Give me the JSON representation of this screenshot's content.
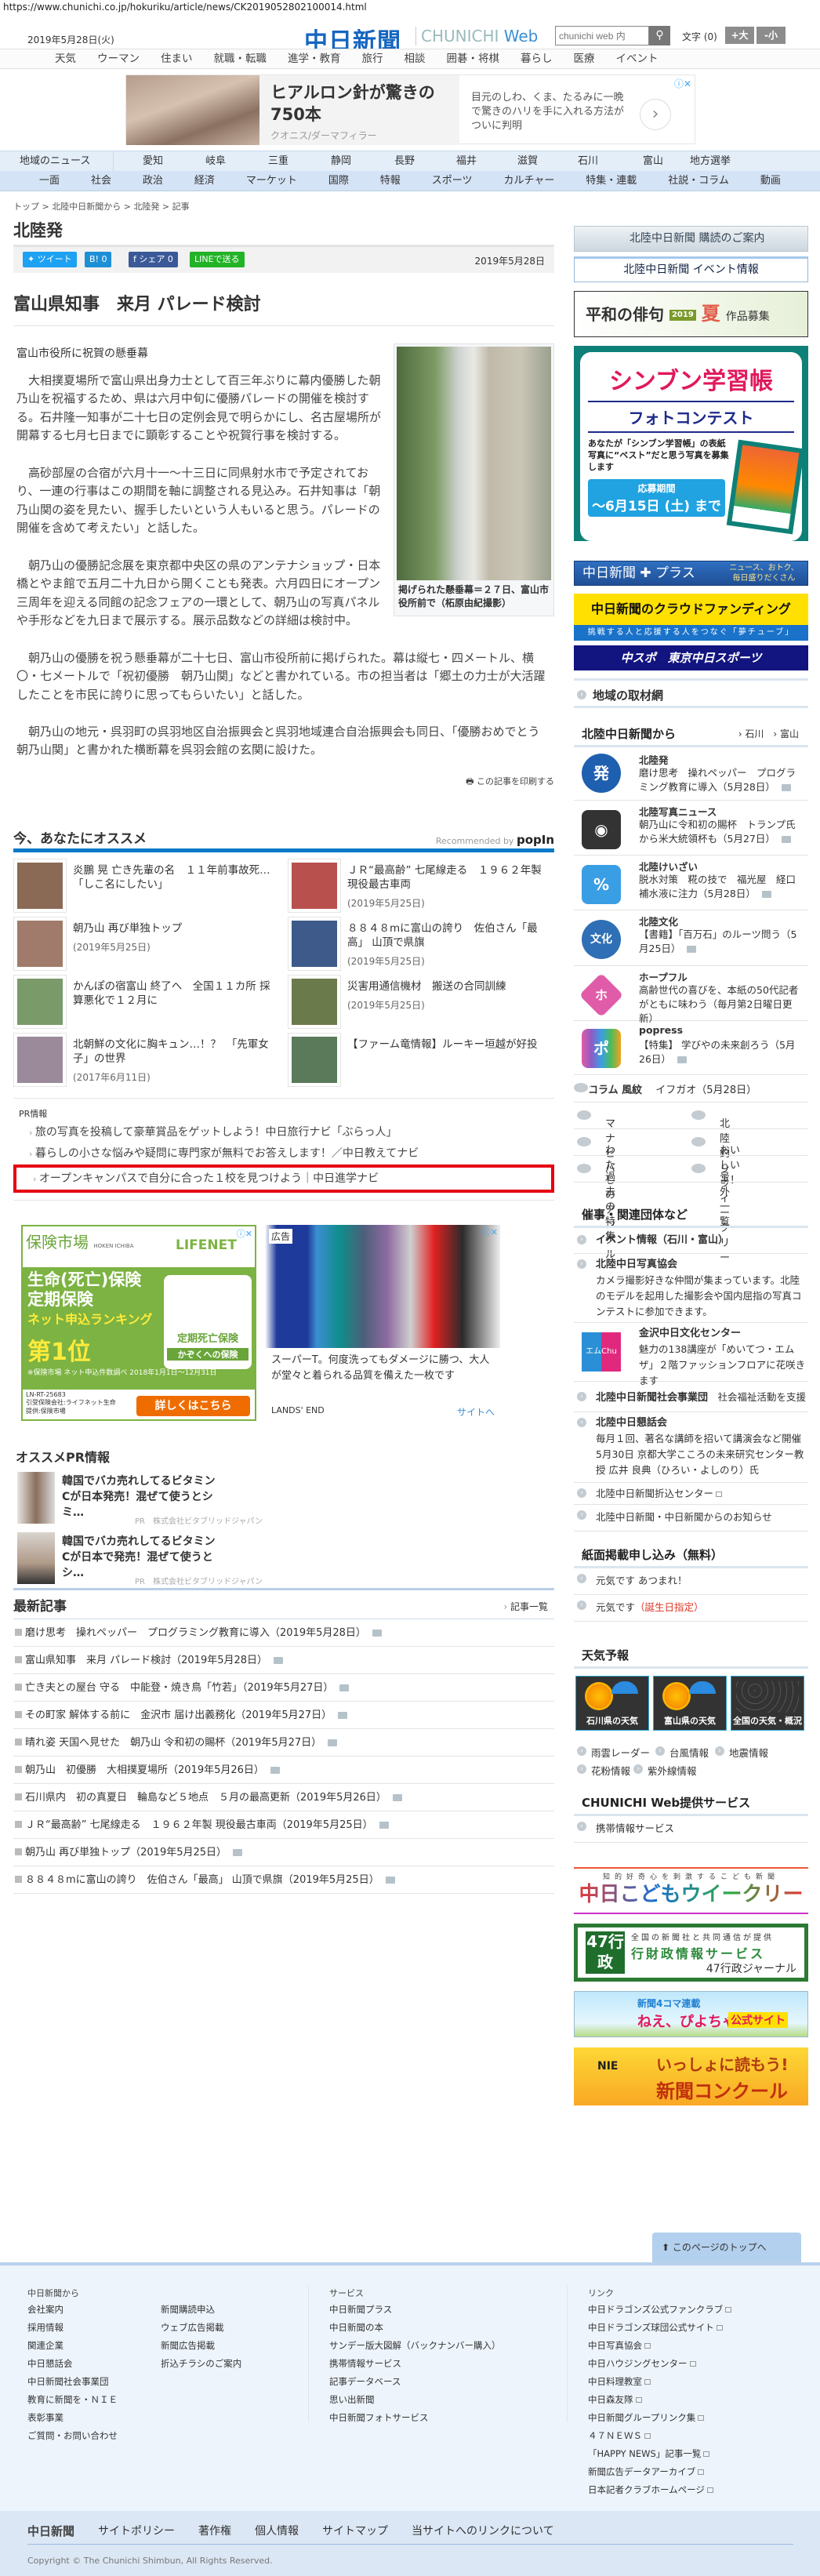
{
  "url": "https://www.chunichi.co.jp/hokuriku/article/news/CK2019052802100014.html",
  "header": {
    "date": "2019年5月28日(火)",
    "logo": "中日新聞",
    "logo_sub_a": "CHUNICHI",
    "logo_sub_b": "Web",
    "search_placeholder": "chunichi web 内",
    "font_label": "文字 (0)",
    "font_larger": "+大",
    "font_smaller": "-小"
  },
  "nav_top": [
    "天気",
    "ウーマン",
    "住まい",
    "就職・転職",
    "進学・教育",
    "旅行",
    "相談",
    "囲碁・将棋",
    "暮らし",
    "医療",
    "イベント"
  ],
  "top_ad": {
    "headline": "ヒアルロン針が驚きの750本",
    "advertiser": "クオニス/ダーマフィラー",
    "body": "目元のしわ、くま、たるみに一晩で驚きのハリを手に入れる方法がついに判明"
  },
  "nav_region": {
    "lead": "地域のニュース",
    "items": [
      "愛知",
      "岐阜",
      "三重",
      "静岡",
      "長野",
      "福井",
      "滋賀",
      "石川",
      "富山",
      "地方選挙"
    ]
  },
  "nav_category": [
    "一面",
    "社会",
    "政治",
    "経済",
    "マーケット",
    "国際",
    "特報",
    "スポーツ",
    "カルチャー",
    "特集・連載",
    "社説・コラム",
    "動画"
  ],
  "breadcrumb": "トップ > 北陸中日新聞から > 北陸発 > 記事",
  "page_title": "北陸発",
  "share": {
    "tweet": "ツイート",
    "hatena": "B! 0",
    "facebook": "f シェア 0",
    "line": "LINEで送る"
  },
  "article": {
    "date": "2019年5月28日",
    "headline": "富山県知事　来月 パレード検討",
    "subtitle": "富山市役所に祝賀の懸垂幕",
    "photo_caption": "掲げられた懸垂幕＝２７日、富山市役所前で（柘原由紀撮影）",
    "paragraphs": [
      "大相撲夏場所で富山県出身力士として百三年ぶりに幕内優勝した朝乃山を祝福するため、県は六月中旬に優勝パレードの開催を検討する。石井隆一知事が二十七日の定例会見で明らかにし、名古屋場所が開幕する七月七日までに顕彰することや祝賀行事を検討する。",
      "高砂部屋の合宿が六月十一～十三日に同県射水市で予定されており、一連の行事はこの期間を軸に調整される見込み。石井知事は「朝乃山関の姿を見たい、握手したいという人もいると思う。パレードの開催を含めて考えたい」と話した。",
      "朝乃山の優勝記念展を東京都中央区の県のアンテナショップ・日本橋とやま館で五月二十九日から開くことも発表。六月四日にオープン三周年を迎える同館の記念フェアの一環として、朝乃山の写真パネルや手形などを九日まで展示する。展示品数などの詳細は検討中。",
      "朝乃山の優勝を祝う懸垂幕が二十七日、富山市役所前に掲げられた。幕は縦七・四メートル、横〇・七メートルで「祝初優勝　朝乃山関」などと書かれている。市の担当者は「郷土の力士が大活躍したことを市民に誇りに思ってもらいたい」と話した。",
      "朝乃山の地元・呉羽町の呉羽地区自治振興会と呉羽地域連合自治振興会も同日、「優勝おめでとう　朝乃山関」と書かれた横断幕を呉羽会館の玄関に設けた。"
    ],
    "print_label": "この記事を印刷する"
  },
  "recommend": {
    "title": "今、あなたにオススメ",
    "by": "Recommended by",
    "brand": "popIn",
    "items": [
      {
        "title": "炎鵬 晃 亡き先輩の名　１１年前事故死…「しこ名にしたい」",
        "date": "",
        "color": "#8a6a55"
      },
      {
        "title": "ＪＲ“最高齢” 七尾線走る　１９６２年製 現役最古車両",
        "date": "(2019年5月25日)",
        "color": "#b8504e"
      },
      {
        "title": "朝乃山 再び単独トップ",
        "date": "(2019年5月25日)",
        "color": "#a07a6a"
      },
      {
        "title": "８８４８mに富山の誇り　佐伯さん「最高」 山頂で県旗",
        "date": "(2019年5月25日)",
        "color": "#3d5a8a"
      },
      {
        "title": "かんぽの宿富山 終了へ　全国１１カ所 採算悪化で１２月に",
        "date": "",
        "color": "#7a9a6a"
      },
      {
        "title": "災害用通信機材　搬送の合同訓練",
        "date": "(2019年5月25日)",
        "color": "#6b7a4a"
      },
      {
        "title": "北朝鮮の文化に胸キュン…！？　「先軍女子」の世界",
        "date": "(2017年6月11日)",
        "color": "#9a8a9a"
      },
      {
        "title": "【ファーム竜情報】ルーキー垣越が好投",
        "date": "",
        "color": "#5a7a5a"
      }
    ]
  },
  "pr": {
    "title": "PR情報",
    "items": [
      "旅の写真を投稿して豪華賞品をゲットしよう！中日旅行ナビ「ぶらっ人」",
      "暮らしの小さな悩みや疑問に専門家が無料でお答えします！／中日教えてナビ",
      "オープンキャンパスで自分に合った１校を見つけよう｜中日進学ナビ"
    ]
  },
  "ad_left": {
    "brand": "保険市場",
    "brand_en": "HOKEN ICHIBA",
    "partner": "LIFENET",
    "line1": "生命(死亡)保険",
    "line2": "定期保険",
    "line3": "ネット申込ランキング",
    "rank": "第1位",
    "box_a": "定期死亡保険",
    "box_b": "かぞくへの保険",
    "note": "※保険市場 ネット申込件数調べ 2018年1月1日～12月31日",
    "code": "LN-RT-25683",
    "insurer": "引受保険会社:ライフネット生命",
    "provider": "提供:保険市場",
    "cta": "詳しくはこちら"
  },
  "ad_right": {
    "label": "広告",
    "text": "スーパーT。何度洗ってもダメージに勝つ、大人が堂々と着られる品質を備えた一枚です",
    "brand": "LANDS' END",
    "link": "サイトへ"
  },
  "osusume_pr": {
    "title": "オススメPR情報",
    "items": [
      {
        "title": "韓国でバカ売れしてるビタミンCが日本発売！混ぜて使うとシミ…",
        "sponsor": "PR　株式会社ビタブリッドジャパン"
      },
      {
        "title": "韓国でバカ売れしてるビタミンCが日本で発売！混ぜて使うとシ…",
        "sponsor": "PR　株式会社ビタブリッドジャパン"
      }
    ]
  },
  "latest": {
    "title": "最新記事",
    "all_link": "記事一覧",
    "items": [
      "磨け思考　操れペッパー　プログラミング教育に導入（2019年5月28日）",
      "富山県知事　来月 パレード検討（2019年5月28日）",
      "亡き夫との屋台 守る　中能登・焼き鳥「竹若」（2019年5月27日）",
      "その町家 解体する前に　金沢市 届け出義務化（2019年5月27日）",
      "晴れ姿 天国へ見せた　朝乃山 令和初の賜杯（2019年5月27日）",
      "朝乃山　初優勝　大相撲夏場所（2019年5月26日）",
      "石川県内　初の真夏日　輪島など５地点　５月の最高更新（2019年5月26日）",
      "ＪＲ“最高齢” 七尾線走る　１９６２年製 現役最古車両（2019年5月25日）",
      "朝乃山 再び単独トップ（2019年5月25日）",
      "８８４８mに富山の誇り　佐伯さん「最高」 山頂で県旗（2019年5月25日）"
    ]
  },
  "sidebar": {
    "kodoku": "北陸中日新聞 購読のご案内",
    "event": "北陸中日新聞 イベント情報",
    "haiku": {
      "a": "平和の俳句",
      "year": "2019",
      "season": "夏",
      "b": "作品募集"
    },
    "gakushu": {
      "title": "シンブン学習帳",
      "sub": "フォトコンテスト",
      "desc": "あなたが「シンブン学習帳」の表紙写真に“ベスト”だと思う写真を募集します",
      "period": "応募期間",
      "deadline": "～6月15日 (土) まで"
    },
    "plus": {
      "title": "中日新聞 ✚ プラス",
      "sub": "ニュース、おトク、毎日盛りだくさん"
    },
    "crowd": {
      "title": "中日新聞のクラウドファンディング",
      "sub": "挑戦する人と応援する人をつなぐ「夢チューブ」"
    },
    "chuspo": "中スポ　東京中日スポーツ",
    "torizai": "地域の取材網",
    "hokuriku": {
      "title": "北陸中日新聞から",
      "links": [
        "石川",
        "富山"
      ],
      "items": [
        {
          "icon": "発",
          "color": "#1f5fb0",
          "name": "北陸発",
          "desc": "磨け思考　操れペッパー　プログラミング教育に導入（5月28日）"
        },
        {
          "icon": "◉",
          "color": "#333333",
          "name": "北陸写真ニュース",
          "desc": "朝乃山に令和初の賜杯　トランプ氏から米大統領杯も（5月27日）"
        },
        {
          "icon": "%",
          "color": "#3a9ee4",
          "name": "北陸けいざい",
          "desc": "脱水対策　糀の技で　福光屋　経口補水液に注力（5月28日）"
        },
        {
          "icon": "文化",
          "color": "#2f6fb5",
          "name": "北陸文化",
          "desc": "【書籍】「百万石」のルーツ問う（5月25日）"
        },
        {
          "icon": "ホ",
          "color": "#e05ca8",
          "name": "ホープフル",
          "desc": "高齢世代の喜びを、本紙の50代記者がともに味わう（毎月第2日曜日更新）"
        },
        {
          "icon": "ポ",
          "color": "#8e5cc4",
          "name": "popress",
          "desc": "【特集】 学びやの未来創ろう（5月26日）"
        }
      ],
      "column_label": "コラム 風紋",
      "column_text": "イフガオ（5月28日）",
      "grid": [
        "マナビバ",
        "北陸釣りウィークリー",
        "わたしのアングル",
        "おいしいよ！",
        "過去の特集",
        "号外一覧"
      ]
    },
    "events": {
      "title": "催事・関連団体など",
      "items": [
        {
          "name": "イベント情報（石川・富山）",
          "desc": ""
        },
        {
          "name": "北陸中日写真協会",
          "desc": "カメラ撮影好きな仲間が集まっています。北陸のモデルを起用した撮影会や国内屈指の写真コンテストに参加できます。"
        },
        {
          "name": "金沢中日文化センター",
          "desc": "魅力の138講座が「めいてつ・エムザ」２階ファッションフロアに花咲きます",
          "logo": "エムChu"
        },
        {
          "name": "北陸中日新聞社会事業団",
          "desc": "社会福祉活動を支援"
        },
        {
          "name": "北陸中日懇話会",
          "desc": "毎月１回、著名な講師を招いて講演会など開催 5月30日 京都大学こころの未来研究センター教授 広井 良典（ひろい・よしのり）氏"
        },
        {
          "name": "北陸中日新聞折込センター",
          "desc": ""
        },
        {
          "name": "北陸中日新聞・中日新聞からのお知らせ",
          "desc": ""
        }
      ]
    },
    "shimen": {
      "title": "紙面掲載申し込み（無料）",
      "items": [
        "元気です あつまれ！",
        "元気です"
      ],
      "red": "（誕生日指定）"
    },
    "weather": {
      "title": "天気予報",
      "tiles": [
        "石川県の天気",
        "富山県の天気",
        "全国の天気・概況"
      ],
      "links": [
        "雨雲レーダー",
        "台風情報",
        "地震情報",
        "花粉情報",
        "紫外線情報"
      ]
    },
    "services": {
      "title": "CHUNICHI Web提供サービス",
      "items": [
        "携帯情報サービス"
      ]
    },
    "kodomo": {
      "slogan": "知的好奇心を刺激するこども新聞",
      "title": "中日こどもウイークリー"
    },
    "gyosei": {
      "logo": "47行政",
      "a": "全国の新聞社と共同通信が提供",
      "b": "行財政情報サービス",
      "c": "47行政ジャーナル"
    },
    "piyo": {
      "a": "新聞4コマ連載",
      "b": "ねえ、ぴよちゃん",
      "c": "公式サイト"
    },
    "nie": {
      "logo": "NIE",
      "a": "いっしょに読もう!",
      "b": "新聞コンクール"
    }
  },
  "footer": {
    "to_top": "このページのトップへ",
    "col1_title": "中日新聞から",
    "col1a": [
      "会社案内",
      "採用情報",
      "関連企業",
      "中日懇話会",
      "中日新聞社会事業団",
      "教育に新聞を・ＮＩＥ",
      "表彰事業",
      "ご質問・お問い合わせ"
    ],
    "col1b": [
      "新聞購読申込",
      "ウェブ広告掲載",
      "新聞広告掲載",
      "折込チラシのご案内"
    ],
    "col2_title": "サービス",
    "col2": [
      "中日新聞プラス",
      "中日新聞の本",
      "サンデー版大図解（バックナンバー購入）",
      "携帯情報サービス",
      "記事データベース",
      "思い出新聞",
      "中日新聞フォトサービス"
    ],
    "col3_title": "リンク",
    "col3": [
      "中日ドラゴンズ公式ファンクラブ",
      "中日ドラゴンズ球団公式サイト",
      "中日写真協会",
      "中日ハウジングセンター",
      "中日料理教室",
      "中日森友隊",
      "中日新聞グループリンク集",
      "４７ＮＥＷＳ",
      "「HAPPY NEWS」記事一覧",
      "新聞広告データアーカイブ",
      "日本記者クラブホームページ"
    ],
    "bottom_logo": "中日新聞",
    "bottom_links": [
      "サイトポリシー",
      "著作権",
      "個人情報",
      "サイトマップ",
      "当サイトへのリンクについて"
    ],
    "copyright": "Copyright © The Chunichi Shimbun, All Rights Reserved."
  },
  "colors": {
    "brand": "#1565c0",
    "rec_bar": "#0a79c6",
    "highlight": "#e60012"
  }
}
